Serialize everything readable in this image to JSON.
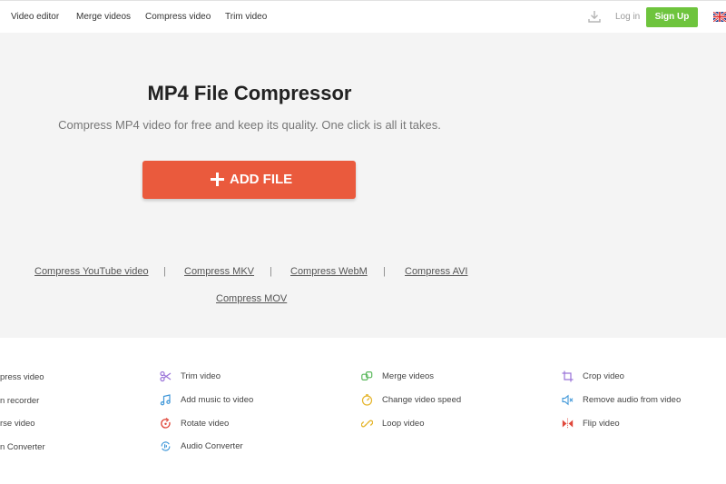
{
  "nav": {
    "items": [
      "Video editor",
      "Merge videos",
      "Compress video",
      "Trim video"
    ],
    "login": "Log in",
    "signup": "Sign Up"
  },
  "hero": {
    "title": "MP4 File Compressor",
    "subtitle": "Compress MP4 video for free and keep its quality. One click is all it takes.",
    "add_file": "ADD FILE"
  },
  "related": {
    "links": [
      "Compress YouTube video",
      "Compress MKV",
      "Compress WebM",
      "Compress AVI",
      "Compress MOV"
    ],
    "separator": "|"
  },
  "tools": {
    "col1": [
      "press video",
      "n recorder",
      "rse video",
      "n Converter"
    ],
    "col2": [
      "Trim video",
      "Add music to video",
      "Rotate video",
      "Audio Converter"
    ],
    "col3": [
      "Merge videos",
      "Change video speed",
      "Loop video"
    ],
    "col4": [
      "Crop video",
      "Remove audio from video",
      "Flip video"
    ]
  },
  "icons": {
    "col2": [
      "scissors-icon",
      "music-note-icon",
      "rotate-icon",
      "audio-converter-icon"
    ],
    "col3": [
      "merge-icon",
      "speedometer-icon",
      "loop-icon"
    ],
    "col4": [
      "crop-icon",
      "mute-icon",
      "flip-icon"
    ]
  },
  "colors": {
    "accent": "#ea5a3d",
    "signup": "#6ec43d",
    "icon_purple": "#9a73d8",
    "icon_blue": "#3f97d8",
    "icon_red": "#e0483b",
    "icon_green": "#5ab85c",
    "icon_yellow": "#e5b52c"
  }
}
